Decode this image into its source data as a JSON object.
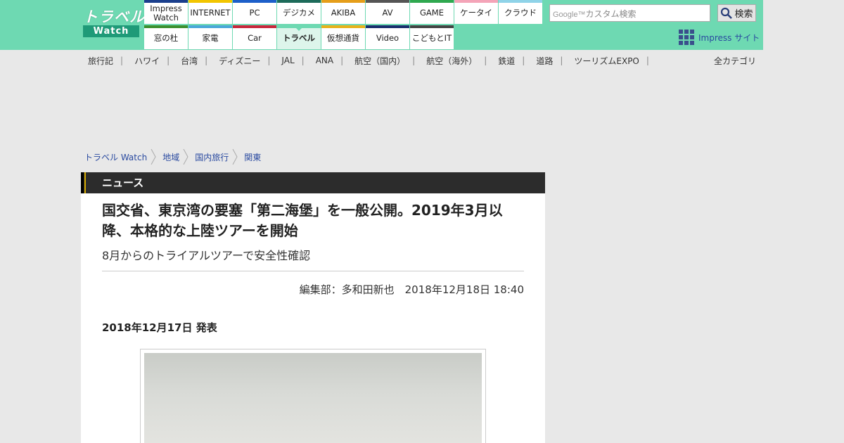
{
  "header": {
    "logo_top": "トラベル",
    "logo_bottom": "Watch",
    "nav_row1": [
      {
        "label": "Impress\nWatch",
        "color": "#1a3e8c"
      },
      {
        "label": "INTERNET",
        "color": "#f2c500"
      },
      {
        "label": "PC",
        "color": "#1d5fc9"
      },
      {
        "label": "デジカメ",
        "color": "#1d6b5a"
      },
      {
        "label": "AKIBA",
        "color": "#e59e1a"
      },
      {
        "label": "AV",
        "color": "#555555"
      },
      {
        "label": "GAME",
        "color": "#2fa84f"
      },
      {
        "label": "ケータイ",
        "color": "#f4a4b8"
      },
      {
        "label": "クラウド",
        "color": "#8fd3e8"
      }
    ],
    "nav_row2": [
      {
        "label": "窓の杜",
        "color": "#3c8f2e"
      },
      {
        "label": "家電",
        "color": "#4aa8d8"
      },
      {
        "label": "Car",
        "color": "#c8283c"
      },
      {
        "label": "トラベル",
        "color": "#6ed9b2",
        "active": true
      },
      {
        "label": "仮想通貨",
        "color": "#e8b21a"
      },
      {
        "label": "Video",
        "color": "#1a2f6e"
      },
      {
        "label": "こどもとIT",
        "color": "#444444"
      }
    ],
    "search_placeholder": "カスタム検索",
    "search_brand": "Google™",
    "search_button": "検索",
    "impress_sites": "Impress サイト"
  },
  "catnav": {
    "items": [
      "旅行記",
      "ハワイ",
      "台湾",
      "ディズニー",
      "JAL",
      "ANA",
      "航空（国内）",
      "航空（海外）",
      "鉄道",
      "道路",
      "ツーリズムEXPO"
    ],
    "all_categories": "全カテゴリ"
  },
  "breadcrumb": [
    "トラベル Watch",
    "地域",
    "国内旅行",
    "関東"
  ],
  "article": {
    "section": "ニュース",
    "title": "国交省、東京湾の要塞「第二海堡」を一般公開。2019年3月以降、本格的な上陸ツアーを開始",
    "subtitle": "8月からのトライアルツアーで安全性確認",
    "byline": "編集部：多和田新也　2018年12月18日 18:40",
    "announce_date": "2018年12月17日 発表"
  }
}
